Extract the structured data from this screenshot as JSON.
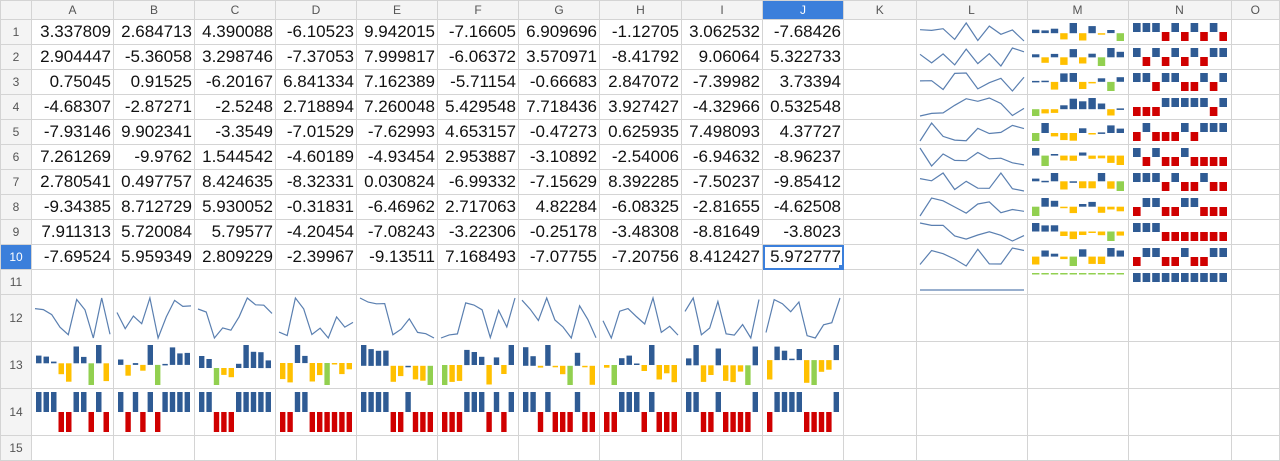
{
  "columns": [
    "A",
    "B",
    "C",
    "D",
    "E",
    "F",
    "G",
    "H",
    "I",
    "J",
    "K",
    "L",
    "M",
    "N",
    "O"
  ],
  "rows": [
    "1",
    "2",
    "3",
    "4",
    "5",
    "6",
    "7",
    "8",
    "9",
    "10",
    "11",
    "12",
    "13",
    "14",
    "15"
  ],
  "selected_cell": {
    "column": "J",
    "row": "10"
  },
  "cells": [
    [
      "3.337809",
      "2.684713",
      "4.390088",
      "-6.10523",
      "9.942015",
      "-7.16605",
      "6.909696",
      "-1.12705",
      "3.062532",
      "-7.68426"
    ],
    [
      "2.904447",
      "-5.36058",
      "3.298746",
      "-7.37053",
      "7.999817",
      "-6.06372",
      "3.570971",
      "-8.41792",
      "9.06064",
      "5.322733"
    ],
    [
      "0.75045",
      "0.91525",
      "-6.20167",
      "6.841334",
      "7.162389",
      "-5.71154",
      "-0.66683",
      "2.847072",
      "-7.39982",
      "3.73394"
    ],
    [
      "-4.68307",
      "-2.87271",
      "-2.5248",
      "2.718894",
      "7.260048",
      "5.429548",
      "7.718436",
      "3.927427",
      "-4.32966",
      "0.532548"
    ],
    [
      "-7.93146",
      "9.902341",
      "-3.3549",
      "-7.01529",
      "-7.62993",
      "4.653157",
      "-0.47273",
      "0.625935",
      "7.498093",
      "4.37727"
    ],
    [
      "7.261269",
      "-9.9762",
      "1.544542",
      "-4.60189",
      "-4.93454",
      "2.953887",
      "-3.10892",
      "-2.54006",
      "-6.94632",
      "-8.96237"
    ],
    [
      "2.780541",
      "0.497757",
      "8.424635",
      "-8.32331",
      "0.030824",
      "-6.99332",
      "-7.15629",
      "8.392285",
      "-7.50237",
      "-9.85412"
    ],
    [
      "-9.34385",
      "8.712729",
      "5.930052",
      "-0.31831",
      "-6.46962",
      "2.717063",
      "4.82284",
      "-6.08325",
      "-2.81655",
      "-4.62508"
    ],
    [
      "7.911313",
      "5.720084",
      "5.79577",
      "-4.20454",
      "-7.08243",
      "-3.22306",
      "-0.25178",
      "-3.48308",
      "-8.81649",
      "-3.8023"
    ],
    [
      "-7.69524",
      "5.959349",
      "2.809229",
      "-2.39967",
      "-9.13511",
      "7.168493",
      "-7.07755",
      "-7.20756",
      "8.412427",
      "5.972777"
    ]
  ],
  "sparklines": {
    "row_sparklines": {
      "L": "line",
      "M": "column",
      "N": "win-loss"
    },
    "column_sparklines": {
      "12": "line",
      "13": "column",
      "14": "win-loss"
    }
  },
  "colors": {
    "line": "#5a7fb0",
    "positive": "#2f5b94",
    "negative": "#ffc000",
    "low": "#92d050",
    "loss": "#d00000",
    "selection": "#3b7fdb"
  }
}
